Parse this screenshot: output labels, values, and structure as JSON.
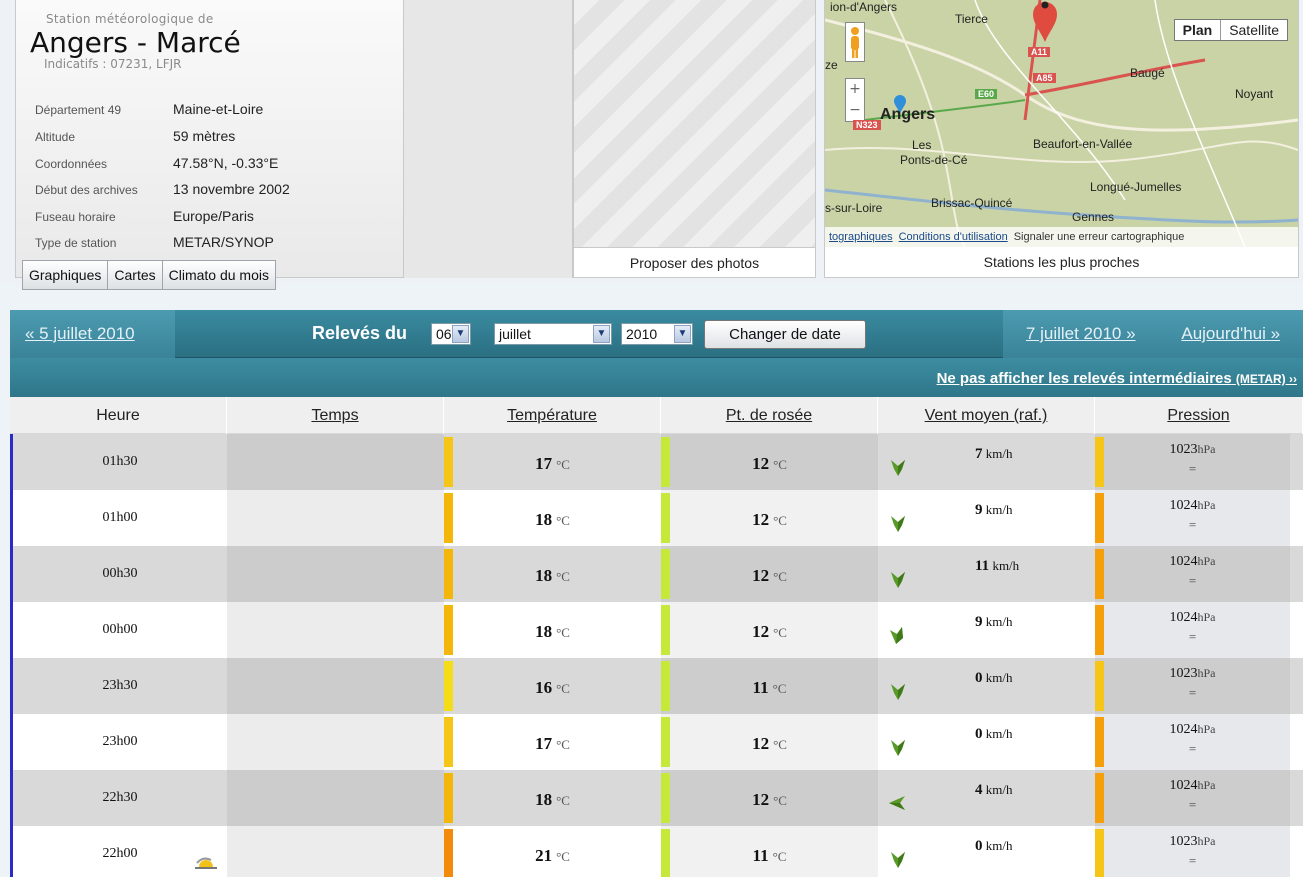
{
  "station": {
    "subtitle": "Station météorologique de",
    "name": "Angers - Marcé",
    "codes": "Indicatifs : 07231, LFJR",
    "info": [
      {
        "label": "Département 49",
        "value": "Maine-et-Loire"
      },
      {
        "label": "Altitude",
        "value": "59 mètres"
      },
      {
        "label": "Coordonnées",
        "value": "47.58°N, -0.33°E"
      },
      {
        "label": "Début des archives",
        "value": "13 novembre 2002"
      },
      {
        "label": "Fuseau horaire",
        "value": "Europe/Paris"
      },
      {
        "label": "Type de station",
        "value": "METAR/SYNOP"
      }
    ]
  },
  "tabs": [
    "Graphiques",
    "Cartes",
    "Climato du mois"
  ],
  "photos": {
    "caption": "Proposer des photos"
  },
  "map": {
    "caption": "Stations les plus proches",
    "plan": "Plan",
    "satellite": "Satellite",
    "footer_link1": "tographiques",
    "footer_link2": "Conditions d'utilisation",
    "footer_text": "Signaler une erreur cartographique",
    "places": {
      "tierce": "Tierce",
      "bauge": "Baugé",
      "noyant": "Noyant",
      "angers": "Angers",
      "les": "Les",
      "ponts": "Ponts-de-Cé",
      "beaufort": "Beaufort-en-Vallée",
      "longue": "Longué-Jumelles",
      "brissac": "Brissac-Quincé",
      "gennes": "Gennes",
      "loire": "s-sur-Loire",
      "ze": "ze",
      "top": "ion-d'Angers"
    },
    "roads": {
      "a11": "A11",
      "a85": "A85",
      "e60": "E60",
      "n323": "N323"
    },
    "colors": {
      "land": "#c9d3a5",
      "road": "#d9534f",
      "green_road": "#5aa84a"
    }
  },
  "nav": {
    "prev": "« 5 juillet 2010",
    "title": "Relevés du",
    "day": "06",
    "month": "juillet",
    "year": "2010",
    "change": "Changer de date",
    "next": "7 juillet 2010 »",
    "today": "Aujourd'hui »",
    "hide_link": "Ne pas afficher les relevés intermédiaires",
    "hide_link_small": "(METAR) ››"
  },
  "columns": [
    "Heure",
    "Temps",
    "Température",
    "Pt. de rosée",
    "Vent moyen (raf.)",
    "Pression"
  ],
  "units": {
    "temp": "°C",
    "wind": "km/h",
    "press": "hPa",
    "trend": "="
  },
  "rows": [
    {
      "hour": "01h30",
      "temp": "17",
      "dew": "12",
      "wind": "7",
      "press": "1023",
      "temp_color": "#f5c518",
      "press_color": "#f5c518",
      "arrow": "down",
      "weather_icon": ""
    },
    {
      "hour": "01h00",
      "temp": "18",
      "dew": "12",
      "wind": "9",
      "press": "1024",
      "temp_color": "#f5b60a",
      "press_color": "#f5a00a",
      "arrow": "down",
      "weather_icon": ""
    },
    {
      "hour": "00h30",
      "temp": "18",
      "dew": "12",
      "wind": "11",
      "press": "1024",
      "temp_color": "#f5b60a",
      "press_color": "#f5a00a",
      "arrow": "down",
      "weather_icon": ""
    },
    {
      "hour": "00h00",
      "temp": "18",
      "dew": "12",
      "wind": "9",
      "press": "1024",
      "temp_color": "#f5b60a",
      "press_color": "#f5a00a",
      "arrow": "down-left",
      "weather_icon": ""
    },
    {
      "hour": "23h30",
      "temp": "16",
      "dew": "11",
      "wind": "0",
      "press": "1023",
      "temp_color": "#f5dc18",
      "press_color": "#f5c518",
      "arrow": "down",
      "weather_icon": ""
    },
    {
      "hour": "23h00",
      "temp": "17",
      "dew": "12",
      "wind": "0",
      "press": "1024",
      "temp_color": "#f5c518",
      "press_color": "#f5a00a",
      "arrow": "down",
      "weather_icon": ""
    },
    {
      "hour": "22h30",
      "temp": "18",
      "dew": "12",
      "wind": "4",
      "press": "1024",
      "temp_color": "#f5b60a",
      "press_color": "#f5a00a",
      "arrow": "left",
      "weather_icon": ""
    },
    {
      "hour": "22h00",
      "temp": "21",
      "dew": "11",
      "wind": "0",
      "press": "1023",
      "temp_color": "#f28a0a",
      "press_color": "#f5c518",
      "arrow": "down",
      "weather_icon": "sunset-cloud-icon"
    }
  ],
  "dew_color": "#c5e83a"
}
